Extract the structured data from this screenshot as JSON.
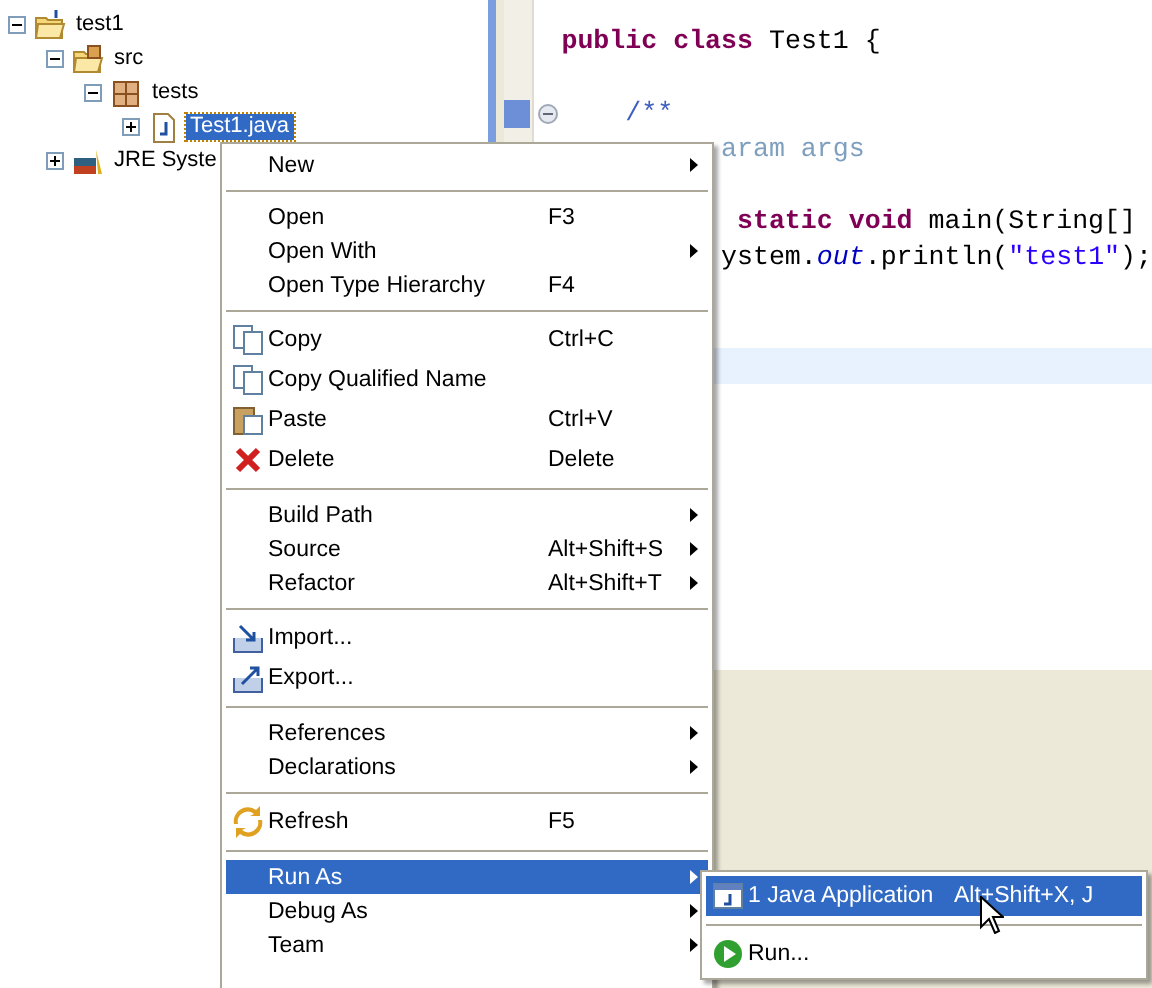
{
  "tree": [
    {
      "label": "test1",
      "kind": "project",
      "expanded": true,
      "selected": false,
      "children": [
        {
          "label": "src",
          "kind": "source-folder",
          "expanded": true,
          "selected": false,
          "children": [
            {
              "label": "tests",
              "kind": "package",
              "expanded": true,
              "selected": false,
              "children": [
                {
                  "label": "Test1.java",
                  "kind": "file",
                  "expanded": false,
                  "selected": true
                }
              ]
            }
          ]
        },
        {
          "label": "JRE Syste",
          "kind": "library",
          "expanded": false,
          "selected": false
        }
      ]
    }
  ],
  "code": [
    {
      "current": false,
      "segments": [
        {
          "text": "public",
          "kind": "keyword"
        },
        {
          "text": " class",
          "kind": "keyword"
        },
        {
          "text": " Test1 {",
          "kind": "plain"
        }
      ]
    },
    {
      "current": false
    },
    {
      "current": false,
      "folding": true,
      "segments": [
        {
          "text": "/**",
          "kind": "javadoc"
        }
      ]
    },
    {
      "current": false,
      "segments": [
        {
          "text": "aram args",
          "kind": "javadoc-tag"
        }
      ]
    },
    {
      "current": false
    },
    {
      "current": false,
      "segments": [
        {
          "text": "static",
          "kind": "keyword"
        },
        {
          "text": " void",
          "kind": "keyword"
        },
        {
          "text": " main(String[]",
          "kind": "plain"
        }
      ]
    },
    {
      "current": false,
      "segments": [
        {
          "text": "ystem.",
          "kind": "plain"
        },
        {
          "text": "out",
          "kind": "field"
        },
        {
          "text": ".println(",
          "kind": "plain"
        },
        {
          "text": "\"test1\"",
          "kind": "string"
        },
        {
          "text": ");",
          "kind": "plain"
        }
      ]
    },
    {
      "current": false
    },
    {
      "current": false
    },
    {
      "current": true
    }
  ],
  "context_menu": [
    {
      "kind": "item",
      "label": "New",
      "submenu": true,
      "selected": false
    },
    {
      "kind": "separator"
    },
    {
      "kind": "item",
      "label": "Open",
      "shortcut": "F3",
      "selected": false
    },
    {
      "kind": "item",
      "label": "Open With",
      "submenu": true,
      "selected": false
    },
    {
      "kind": "item",
      "label": "Open Type Hierarchy",
      "shortcut": "F4",
      "selected": false
    },
    {
      "kind": "separator"
    },
    {
      "kind": "item",
      "label": "Copy",
      "shortcut": "Ctrl+C",
      "selected": false
    },
    {
      "kind": "item",
      "label": "Copy Qualified Name",
      "selected": false
    },
    {
      "kind": "item",
      "label": "Paste",
      "shortcut": "Ctrl+V",
      "selected": false
    },
    {
      "kind": "item",
      "label": "Delete",
      "shortcut": "Delete",
      "selected": false
    },
    {
      "kind": "separator"
    },
    {
      "kind": "item",
      "label": "Build Path",
      "submenu": true,
      "selected": false
    },
    {
      "kind": "item",
      "label": "Source",
      "shortcut": "Alt+Shift+S",
      "submenu": true,
      "selected": false
    },
    {
      "kind": "item",
      "label": "Refactor",
      "shortcut": "Alt+Shift+T",
      "submenu": true,
      "selected": false
    },
    {
      "kind": "separator"
    },
    {
      "kind": "item",
      "label": "Import...",
      "selected": false
    },
    {
      "kind": "item",
      "label": "Export...",
      "selected": false
    },
    {
      "kind": "separator"
    },
    {
      "kind": "item",
      "label": "References",
      "submenu": true,
      "selected": false
    },
    {
      "kind": "item",
      "label": "Declarations",
      "submenu": true,
      "selected": false
    },
    {
      "kind": "separator"
    },
    {
      "kind": "item",
      "label": "Refresh",
      "shortcut": "F5",
      "selected": false
    },
    {
      "kind": "separator"
    },
    {
      "kind": "item",
      "label": "Run As",
      "submenu": true,
      "selected": true
    },
    {
      "kind": "item",
      "label": "Debug As",
      "submenu": true,
      "selected": false
    },
    {
      "kind": "item",
      "label": "Team",
      "submenu": true,
      "selected": false
    }
  ],
  "run_as_menu": [
    {
      "kind": "item",
      "label": "1 Java Application",
      "shortcut": "Alt+Shift+X, J",
      "selected": true
    },
    {
      "kind": "separator"
    },
    {
      "kind": "item",
      "label": "Run...",
      "selected": false
    }
  ]
}
